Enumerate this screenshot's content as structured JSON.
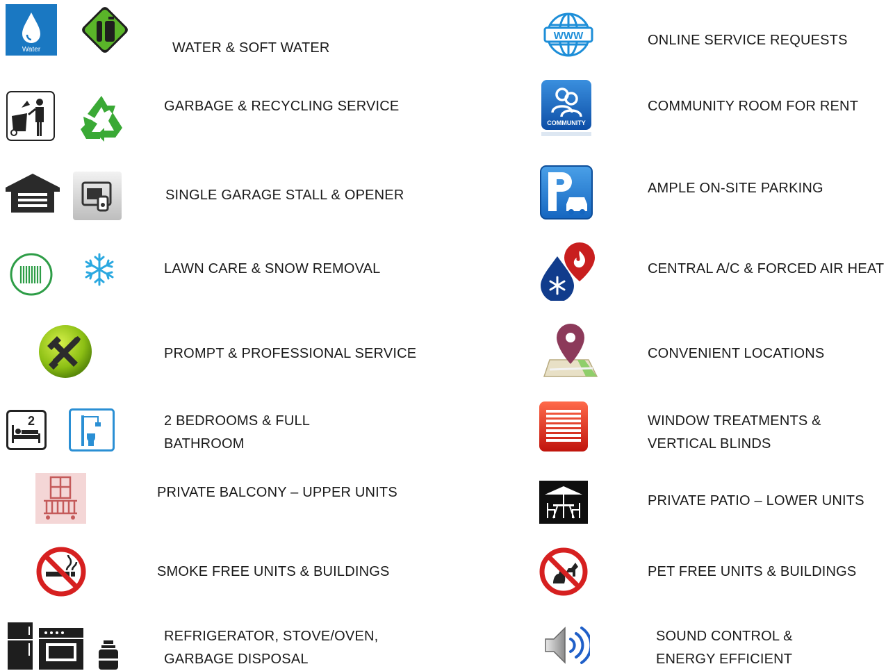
{
  "icons": {
    "water_caption": "Water",
    "community_caption": "COMMUNITY",
    "www_caption": "WWW",
    "bedroom_count": "2"
  },
  "left": [
    {
      "lines": [
        "WATER & SOFT WATER"
      ],
      "icons": [
        "water-drop-icon",
        "water-softener-icon"
      ]
    },
    {
      "lines": [
        "GARBAGE & RECYCLING SERVICE"
      ],
      "icons": [
        "garbage-icon",
        "recycling-icon"
      ]
    },
    {
      "lines": [
        "SINGLE GARAGE STALL & OPENER"
      ],
      "icons": [
        "garage-icon",
        "garage-opener-icon"
      ]
    },
    {
      "lines": [
        "LAWN CARE & SNOW REMOVAL"
      ],
      "icons": [
        "lawn-icon",
        "snowflake-icon"
      ]
    },
    {
      "lines": [
        "PROMPT & PROFESSIONAL SERVICE"
      ],
      "icons": [
        "tools-icon"
      ]
    },
    {
      "lines": [
        "2 BEDROOMS & FULL",
        "BATHROOM"
      ],
      "icons": [
        "bedroom-icon",
        "bathroom-icon"
      ]
    },
    {
      "lines": [
        "PRIVATE BALCONY – UPPER UNITS"
      ],
      "icons": [
        "balcony-icon"
      ]
    },
    {
      "lines": [
        "SMOKE FREE UNITS & BUILDINGS"
      ],
      "icons": [
        "no-smoking-icon"
      ]
    },
    {
      "lines": [
        "REFRIGERATOR, STOVE/OVEN,",
        "GARBAGE DISPOSAL"
      ],
      "icons": [
        "refrigerator-icon",
        "stove-icon",
        "disposal-icon"
      ]
    }
  ],
  "right": [
    {
      "lines": [
        "ONLINE SERVICE REQUESTS"
      ],
      "icons": [
        "globe-www-icon"
      ]
    },
    {
      "lines": [
        "COMMUNITY ROOM FOR RENT"
      ],
      "icons": [
        "community-icon"
      ]
    },
    {
      "lines": [
        "AMPLE ON-SITE PARKING"
      ],
      "icons": [
        "parking-icon"
      ]
    },
    {
      "lines": [
        "CENTRAL A/C & FORCED AIR HEAT"
      ],
      "icons": [
        "ac-heat-icon"
      ]
    },
    {
      "lines": [
        "CONVENIENT LOCATIONS"
      ],
      "icons": [
        "map-pin-icon"
      ]
    },
    {
      "lines": [
        "WINDOW TREATMENTS &",
        "VERTICAL BLINDS"
      ],
      "icons": [
        "blinds-icon"
      ]
    },
    {
      "lines": [
        "PRIVATE PATIO – LOWER UNITS"
      ],
      "icons": [
        "patio-icon"
      ]
    },
    {
      "lines": [
        "PET FREE UNITS & BUILDINGS"
      ],
      "icons": [
        "no-pets-icon"
      ]
    },
    {
      "lines": [
        "SOUND CONTROL  &",
        "ENERGY EFFICIENT"
      ],
      "icons": [
        "speaker-icon"
      ]
    }
  ]
}
